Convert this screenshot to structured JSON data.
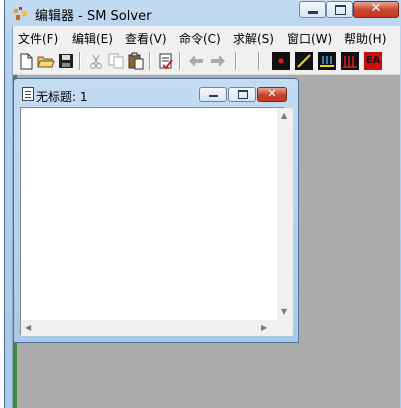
{
  "window": {
    "title": "编辑器 - SM Solver",
    "minimize_label": "",
    "close_label": "✕"
  },
  "menu": [
    {
      "label": "文件(F)",
      "name": "menu-file"
    },
    {
      "label": "编辑(E)",
      "name": "menu-edit"
    },
    {
      "label": "查看(V)",
      "name": "menu-view"
    },
    {
      "label": "命令(C)",
      "name": "menu-command"
    },
    {
      "label": "求解(S)",
      "name": "menu-solve"
    },
    {
      "label": "窗口(W)",
      "name": "menu-window"
    },
    {
      "label": "帮助(H)",
      "name": "menu-help"
    }
  ],
  "toolbar": {
    "icons": [
      "new-file-icon",
      "open-folder-icon",
      "save-icon",
      "cut-icon",
      "copy-icon",
      "paste-icon",
      "check-document-icon",
      "back-arrow-icon",
      "forward-arrow-icon",
      "red-point-icon",
      "yellow-line-icon",
      "yellow-arrows-icon",
      "red-bars-icon",
      "ea-icon"
    ],
    "ea_label": "EA"
  },
  "child": {
    "title": "无标题: 1",
    "close_label": "✕",
    "editor_text": ""
  },
  "colors": {
    "accent_red": "#c8432b",
    "mdi_background": "#ababab",
    "title_bar": "#b6d2ee"
  }
}
